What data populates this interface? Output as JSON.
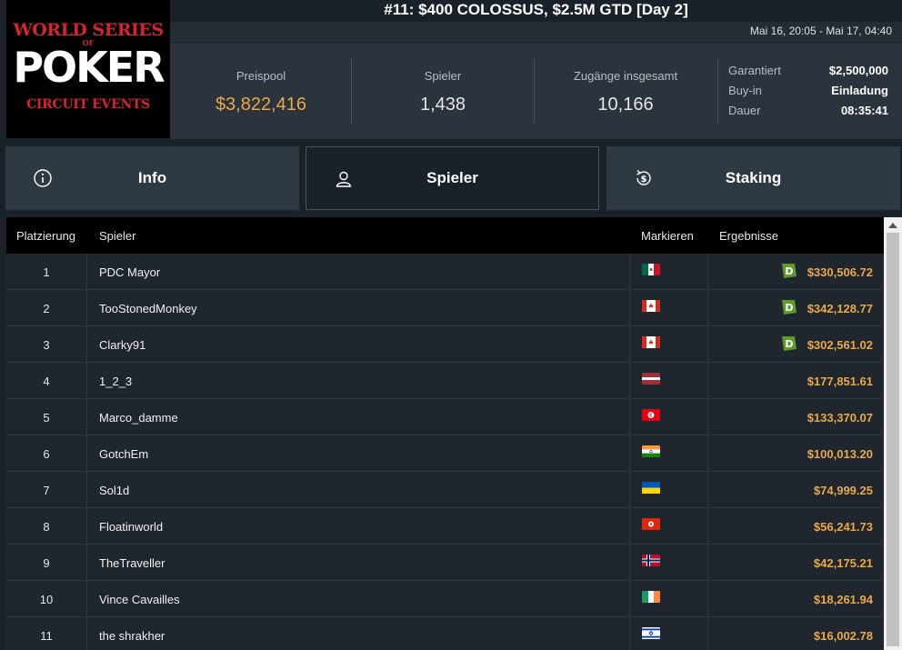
{
  "logo": {
    "line1": "WORLD SERIES",
    "line2": "OF",
    "line3": "POKER",
    "line4": "CIRCUIT EVENTS"
  },
  "title": "#11: $400 COLOSSUS, $2.5M GTD [Day 2]",
  "date_range": "Mai 16, 20:05 - Mai 17, 04:40",
  "stats": {
    "prizepool_label": "Preispool",
    "prizepool_value": "$3,822,416",
    "players_label": "Spieler",
    "players_value": "1,438",
    "entries_label": "Zugänge insgesamt",
    "entries_value": "10,166"
  },
  "info": [
    {
      "key": "Garantiert",
      "value": "$2,500,000"
    },
    {
      "key": "Buy-in",
      "value": "Einladung"
    },
    {
      "key": "Dauer",
      "value": "08:35:41"
    }
  ],
  "tabs": [
    {
      "label": "Info",
      "icon": "info-circle-icon"
    },
    {
      "label": "Spieler",
      "icon": "user-icon"
    },
    {
      "label": "Staking",
      "icon": "dollar-refresh-icon"
    }
  ],
  "table": {
    "headers": {
      "place": "Platzierung",
      "player": "Spieler",
      "mark": "Markieren",
      "results": "Ergebnisse"
    },
    "rows": [
      {
        "place": "1",
        "name": "PDC Mayor",
        "flag": "mexico",
        "amount": "$330,506.72",
        "badge": "D"
      },
      {
        "place": "2",
        "name": "TooStonedMonkey",
        "flag": "canada",
        "amount": "$342,128.77",
        "badge": "D"
      },
      {
        "place": "3",
        "name": "Clarky91",
        "flag": "canada",
        "amount": "$302,561.02",
        "badge": "D"
      },
      {
        "place": "4",
        "name": "1_2_3",
        "flag": "latvia",
        "amount": "$177,851.61",
        "badge": ""
      },
      {
        "place": "5",
        "name": "Marco_damme",
        "flag": "tunisia",
        "amount": "$133,370.07",
        "badge": ""
      },
      {
        "place": "6",
        "name": "GotchEm",
        "flag": "india",
        "amount": "$100,013.20",
        "badge": ""
      },
      {
        "place": "7",
        "name": "Sol1d",
        "flag": "ukraine",
        "amount": "$74,999.25",
        "badge": ""
      },
      {
        "place": "8",
        "name": "Floatinworld",
        "flag": "hongkong",
        "amount": "$56,241.73",
        "badge": ""
      },
      {
        "place": "9",
        "name": "TheTraveller",
        "flag": "norway",
        "amount": "$42,175.21",
        "badge": ""
      },
      {
        "place": "10",
        "name": "Vince Cavailles",
        "flag": "ireland",
        "amount": "$18,261.94",
        "badge": ""
      },
      {
        "place": "11",
        "name": "the shrakher",
        "flag": "israel",
        "amount": "$16,002.78",
        "badge": ""
      }
    ]
  },
  "colors": {
    "accent_gold": "#e9a84a",
    "badge_green": "#5c9a2c",
    "bg": "#1a2128"
  }
}
